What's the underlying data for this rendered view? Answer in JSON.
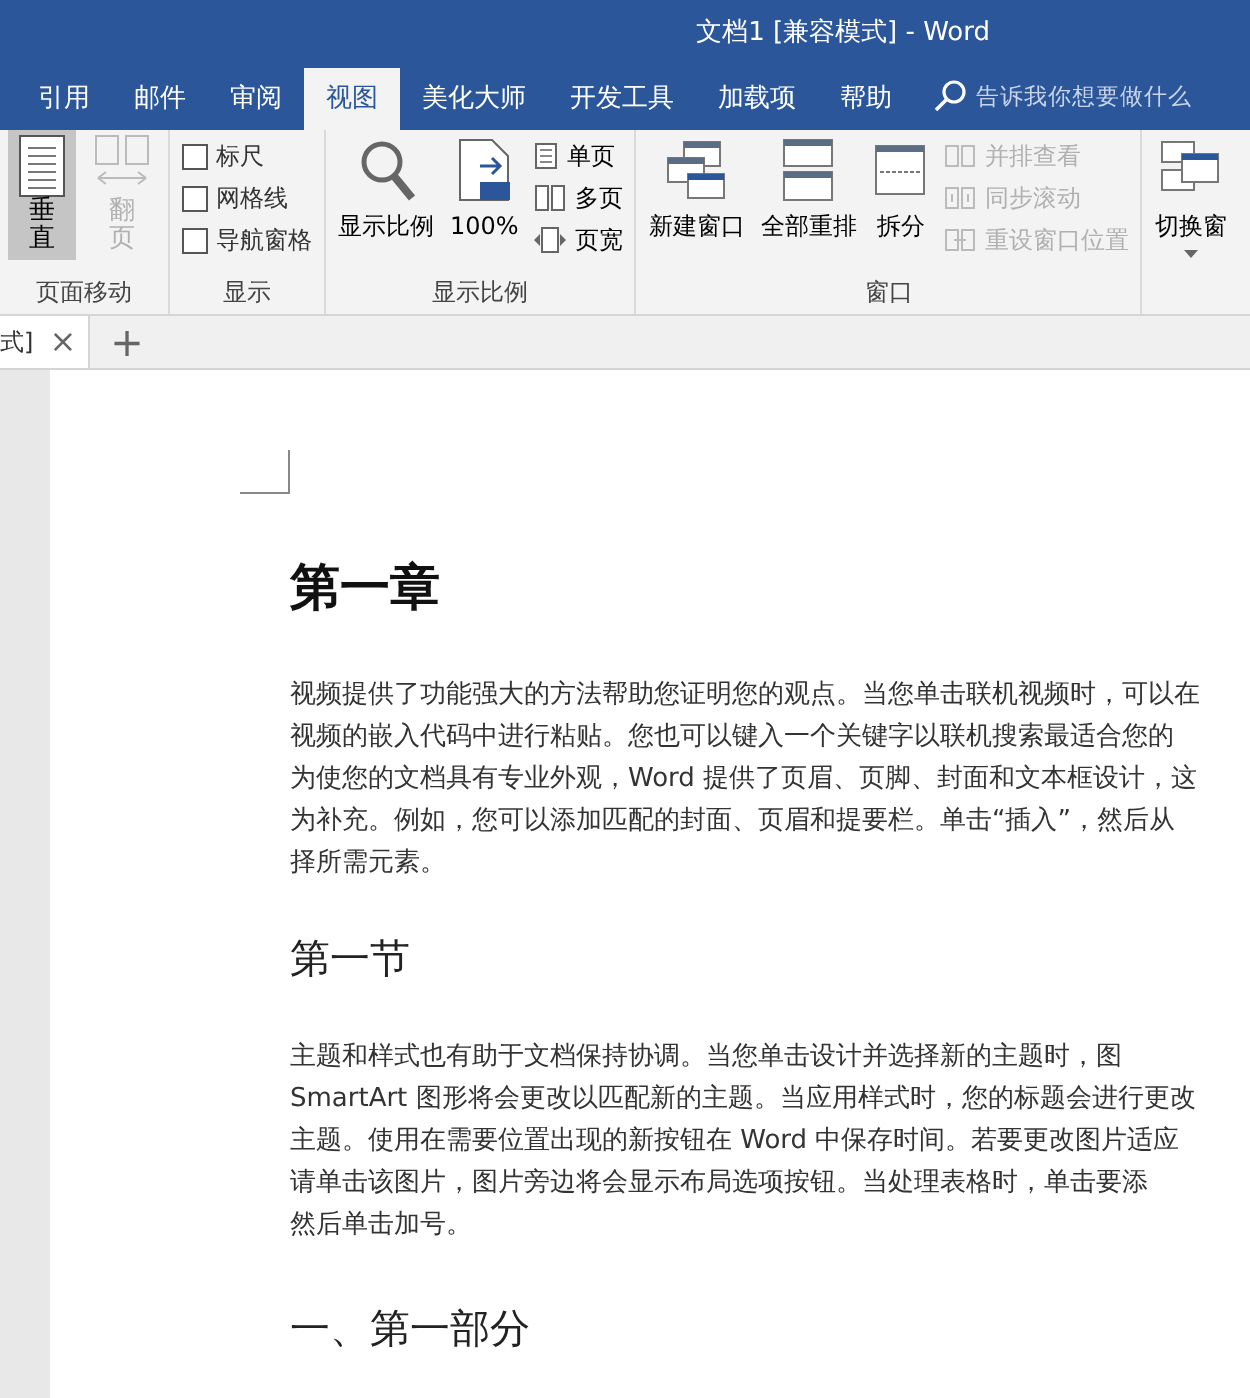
{
  "window": {
    "title": "文档1 [兼容模式]  -  Word"
  },
  "tabs": [
    {
      "label": "引用",
      "selected": false
    },
    {
      "label": "邮件",
      "selected": false
    },
    {
      "label": "审阅",
      "selected": false
    },
    {
      "label": "视图",
      "selected": true
    },
    {
      "label": "美化大师",
      "selected": false
    },
    {
      "label": "开发工具",
      "selected": false
    },
    {
      "label": "加载项",
      "selected": false
    },
    {
      "label": "帮助",
      "selected": false
    }
  ],
  "search": {
    "placeholder": "告诉我你想要做什么"
  },
  "ribbon_groups": [
    {
      "label": "页面移动",
      "items": [
        {
          "kind": "vertical",
          "label": "垂直",
          "selected": true,
          "disabled": false
        },
        {
          "kind": "sideways",
          "label": "翻页",
          "selected": false,
          "disabled": true
        }
      ]
    },
    {
      "label": "显示",
      "items": [
        {
          "kind": "checkbox",
          "label": "标尺",
          "checked": false
        },
        {
          "kind": "checkbox",
          "label": "网格线",
          "checked": false
        },
        {
          "kind": "checkbox",
          "label": "导航窗格",
          "checked": false
        }
      ]
    },
    {
      "label": "显示比例",
      "items": [
        {
          "kind": "zoom",
          "label": "显示比例"
        },
        {
          "kind": "hundred",
          "label": "100%"
        },
        {
          "kind": "onepage",
          "label": "单页"
        },
        {
          "kind": "multipage",
          "label": "多页"
        },
        {
          "kind": "pagewidth",
          "label": "页宽"
        }
      ]
    },
    {
      "label": "窗口",
      "items": [
        {
          "kind": "newwindow",
          "label": "新建窗口"
        },
        {
          "kind": "arrange",
          "label": "全部重排"
        },
        {
          "kind": "split",
          "label": "拆分"
        },
        {
          "kind": "sidebyside",
          "label": "并排查看",
          "disabled": true
        },
        {
          "kind": "syncscroll",
          "label": "同步滚动",
          "disabled": true
        },
        {
          "kind": "resetpos",
          "label": "重设窗口位置",
          "disabled": true
        }
      ]
    },
    {
      "items": [
        {
          "kind": "switch",
          "label": "切换窗"
        }
      ]
    }
  ],
  "doc_tab": {
    "label": "式]",
    "close": "×",
    "add": "+"
  },
  "document": [
    {
      "kind": "h1",
      "text": "第一章"
    },
    {
      "kind": "para",
      "lines": [
        "视频提供了功能强大的方法帮助您证明您的观点。当您单击联机视频时，可以在",
        "视频的嵌入代码中进行粘贴。您也可以键入一个关键字以联机搜索最适合您的",
        "为使您的文档具有专业外观，Word 提供了页眉、页脚、封面和文本框设计，这",
        "为补充。例如，您可以添加匹配的封面、页眉和提要栏。单击“插入”，然后从",
        "择所需元素。"
      ]
    },
    {
      "kind": "h2",
      "text": "第一节"
    },
    {
      "kind": "para",
      "lines": [
        "主题和样式也有助于文档保持协调。当您单击设计并选择新的主题时，图",
        "SmartArt 图形将会更改以匹配新的主题。当应用样式时，您的标题会进行更改",
        "主题。使用在需要位置出现的新按钮在 Word 中保存时间。若要更改图片适应",
        "请单击该图片，图片旁边将会显示布局选项按钮。当处理表格时，单击要添",
        "然后单击加号。"
      ]
    },
    {
      "kind": "h3",
      "text": "一、第一部分"
    }
  ]
}
